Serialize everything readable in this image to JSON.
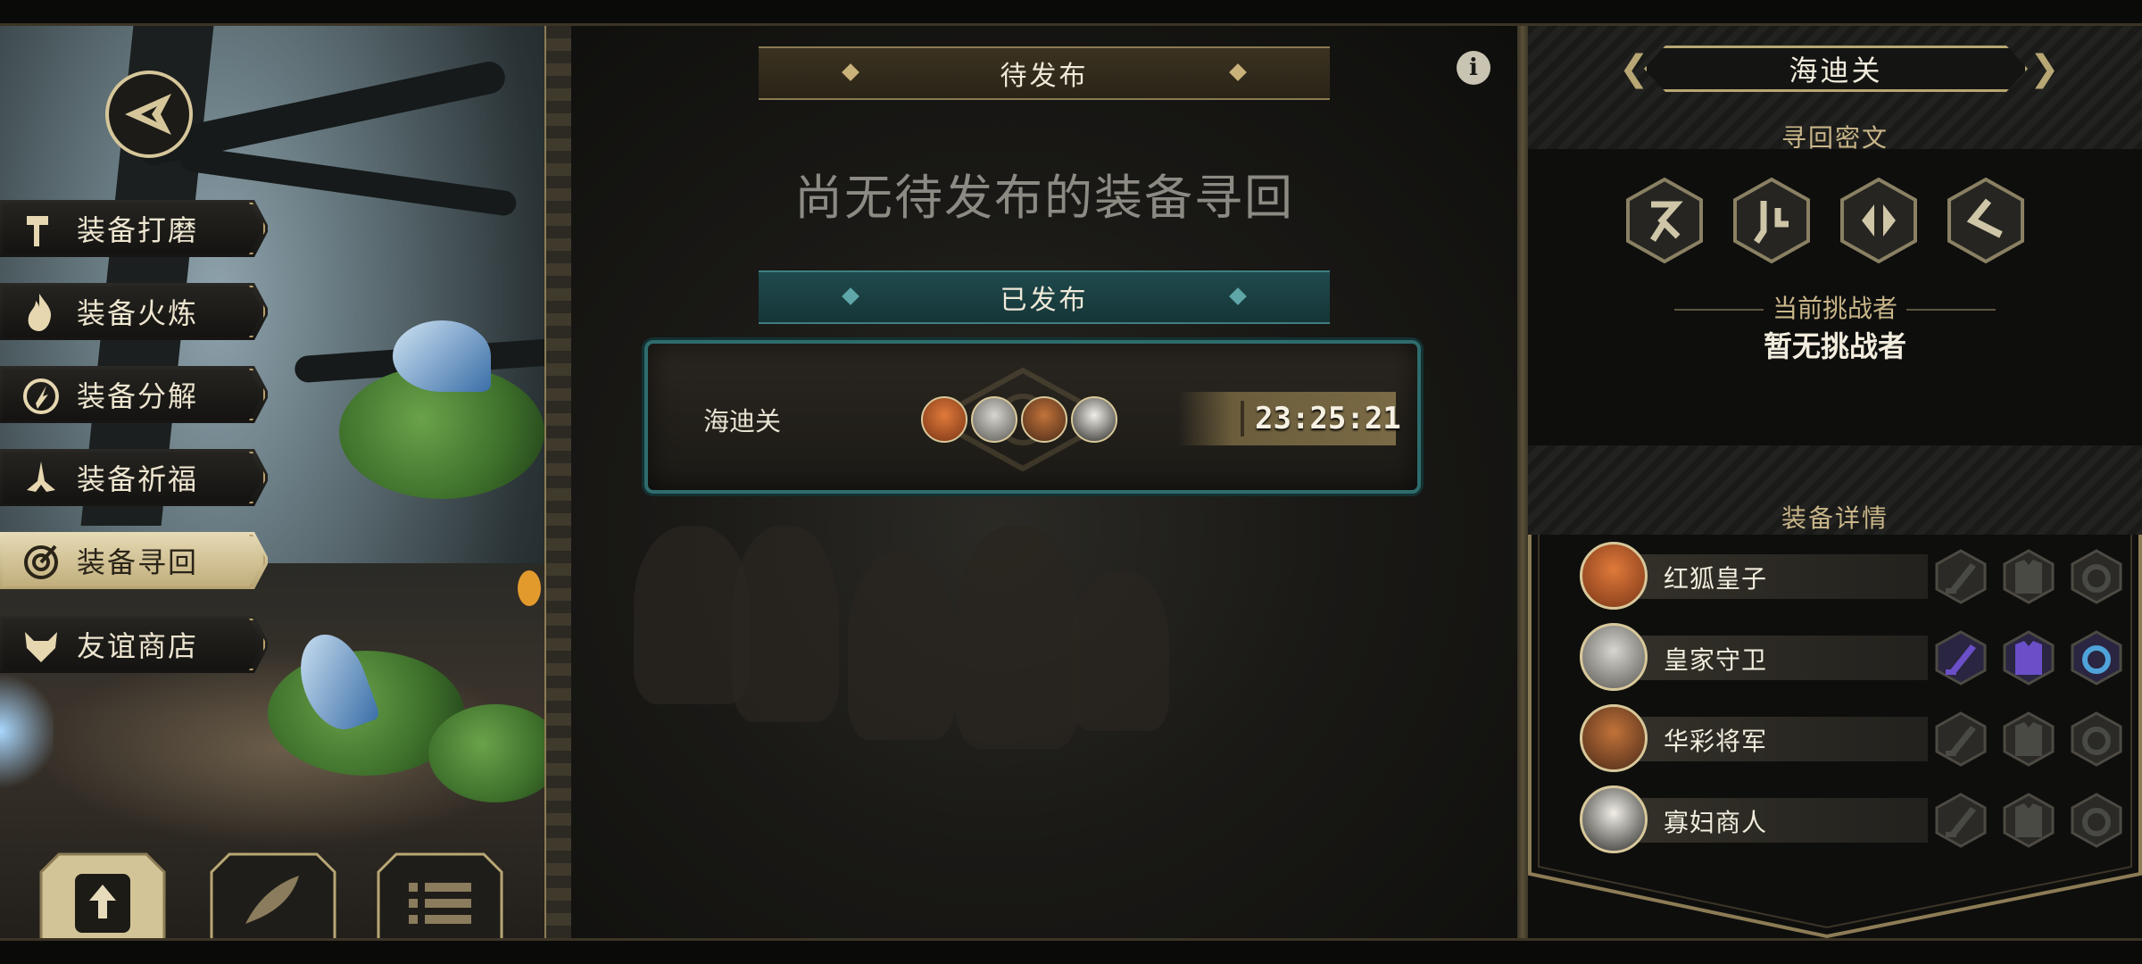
{
  "left_menu": [
    {
      "id": "polish",
      "label": "装备打磨",
      "icon": "hammer-icon"
    },
    {
      "id": "temper",
      "label": "装备火炼",
      "icon": "flame-icon"
    },
    {
      "id": "salvage",
      "label": "装备分解",
      "icon": "salvage-icon"
    },
    {
      "id": "bless",
      "label": "装备祈福",
      "icon": "praying-hands-icon"
    },
    {
      "id": "retrieve",
      "label": "装备寻回",
      "icon": "target-icon",
      "active": true
    },
    {
      "id": "shop",
      "label": "友谊商店",
      "icon": "fox-head-icon"
    }
  ],
  "center": {
    "pending_title": "待发布",
    "empty_message": "尚无待发布的装备寻回",
    "published_title": "已发布",
    "published_quests": [
      {
        "location": "海迪关",
        "timer": "23:25:21",
        "heroes": [
          "red-fox-prince",
          "royal-guard",
          "general",
          "widow-merchant"
        ]
      }
    ]
  },
  "right": {
    "location_title": "海迪关",
    "cipher_title": "寻回密文",
    "runes": [
      "rune-1-icon",
      "rune-2-icon",
      "rune-3-icon",
      "rune-4-icon"
    ],
    "challenger_label": "当前挑战者",
    "challenger_value": "暂无挑战者",
    "equipment_title": "装备详情",
    "heroes": [
      {
        "name": "红狐皇子",
        "weapon": "locked",
        "armor": "locked",
        "trinket": "locked"
      },
      {
        "name": "皇家守卫",
        "weapon": "purple",
        "armor": "purple",
        "trinket": "blue"
      },
      {
        "name": "华彩将军",
        "weapon": "locked",
        "armor": "locked",
        "trinket": "locked"
      },
      {
        "name": "寡妇商人",
        "weapon": "locked",
        "armor": "locked",
        "trinket": "locked"
      }
    ]
  },
  "colors": {
    "gold": "#b8a774",
    "teal": "#2f6c6d",
    "purple": "#6a4fc9",
    "blue": "#4fa3d9",
    "locked": "#4a4a45"
  }
}
